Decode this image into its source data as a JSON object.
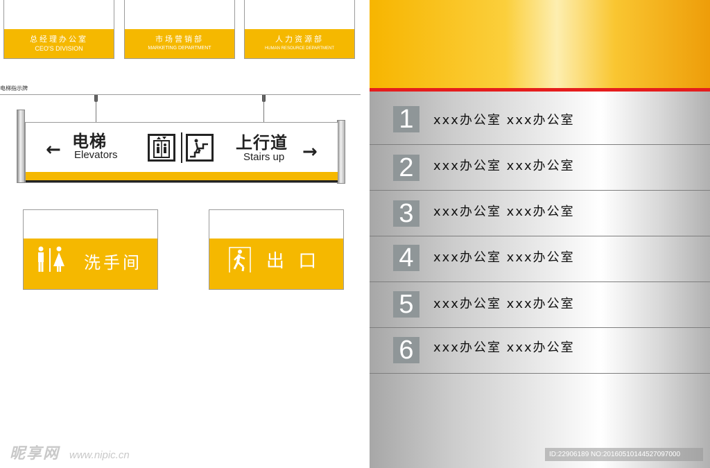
{
  "dept_signs": [
    {
      "zh": "总经理办公室",
      "en": "CEO'S DIVISION"
    },
    {
      "zh": "市场营销部",
      "en": "MARKETING DEPARTMENT"
    },
    {
      "zh": "人力资源部",
      "en": "HUMAN RESOURCE DEPARTMENT"
    }
  ],
  "elevator_section": {
    "caption": "电梯指示牌",
    "left_zh": "电梯",
    "left_en": "Elevators",
    "right_zh": "上行道",
    "right_en": "Stairs up",
    "left_arrow": "←",
    "right_arrow": "→",
    "icons": [
      "elevator-icon",
      "stairs-up-icon"
    ]
  },
  "toilet_sign": {
    "label": "洗手间",
    "icon": "restroom-icon"
  },
  "exit_sign": {
    "label": "出 口",
    "icon": "exit-running-man-icon"
  },
  "watermark": {
    "logo": "昵享网",
    "url": "www.nipic.cn"
  },
  "directory": {
    "rows": [
      {
        "num": "1",
        "text": "xxx办公室 xxx办公室"
      },
      {
        "num": "2",
        "text": "xxx办公室 xxx办公室"
      },
      {
        "num": "3",
        "text": "xxx办公室 xxx办公室"
      },
      {
        "num": "4",
        "text": "xxx办公室 xxx办公室"
      },
      {
        "num": "5",
        "text": "xxx办公室 xxx办公室"
      },
      {
        "num": "6",
        "text": "xxx办公室 xxx办公室"
      }
    ],
    "id_text": "ID:22906189 NO:20160510144527097000"
  },
  "colors": {
    "accent": "#f5b800",
    "red_rule": "#e51d1d",
    "number_box": "#8f9698"
  }
}
